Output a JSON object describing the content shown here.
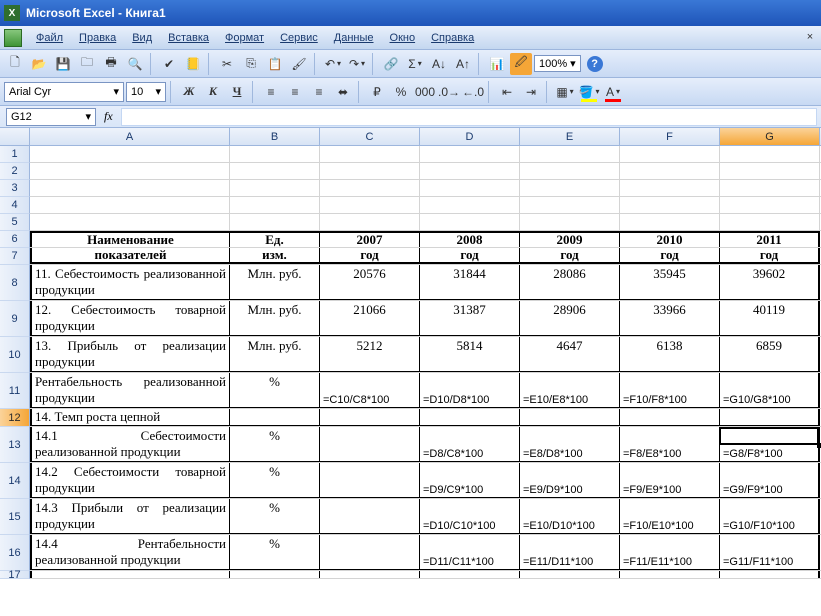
{
  "app": {
    "title": "Microsoft Excel - Книга1"
  },
  "menu": {
    "file": "Файл",
    "edit": "Правка",
    "view": "Вид",
    "insert": "Вставка",
    "format": "Формат",
    "tools": "Сервис",
    "data": "Данные",
    "window": "Окно",
    "help": "Справка"
  },
  "toolbar1": {
    "zoom": "100%"
  },
  "toolbar2": {
    "font_name": "Arial Cyr",
    "font_size": "10",
    "bold": "Ж",
    "italic": "К",
    "underline": "Ч"
  },
  "namebox": "G12",
  "columns": [
    "A",
    "B",
    "C",
    "D",
    "E",
    "F",
    "G"
  ],
  "rows": [
    "1",
    "2",
    "3",
    "4",
    "5",
    "6",
    "7",
    "8",
    "9",
    "10",
    "11",
    "12",
    "13",
    "14",
    "15",
    "16",
    "17"
  ],
  "selected_row": "12",
  "selected_col": "G",
  "table": {
    "header1": {
      "A": "Наименование",
      "B": "Ед.",
      "C": "2007",
      "D": "2008",
      "E": "2009",
      "F": "2010",
      "G": "2011"
    },
    "header2": {
      "A": "показателей",
      "B": "изм.",
      "C": "год",
      "D": "год",
      "E": "год",
      "F": "год",
      "G": "год"
    },
    "r8": {
      "A": "11. Себестоимость реализованной продукции",
      "B": "Млн. руб.",
      "C": "20576",
      "D": "31844",
      "E": "28086",
      "F": "35945",
      "G": "39602"
    },
    "r9": {
      "A": "12. Себестоимость товарной продукции",
      "B": "Млн. руб.",
      "C": "21066",
      "D": "31387",
      "E": "28906",
      "F": "33966",
      "G": "40119"
    },
    "r10": {
      "A": "13. Прибыль от реализации продукции",
      "B": "Млн. руб.",
      "C": "5212",
      "D": "5814",
      "E": "4647",
      "F": "6138",
      "G": "6859"
    },
    "r11": {
      "A": "Рентабельность реализованной продукции",
      "B": "%",
      "C": "=C10/C8*100",
      "D": "=D10/D8*100",
      "E": "=E10/E8*100",
      "F": "=F10/F8*100",
      "G": "=G10/G8*100"
    },
    "r12": {
      "A": "14. Темп роста цепной",
      "B": "",
      "C": "",
      "D": "",
      "E": "",
      "F": "",
      "G": ""
    },
    "r13": {
      "A": "14.1 Себестоимости реализованной продукции",
      "B": "%",
      "C": "",
      "D": "=D8/C8*100",
      "E": "=E8/D8*100",
      "F": "=F8/E8*100",
      "G": "=G8/F8*100"
    },
    "r14": {
      "A": "14.2 Себестоимости товарной продукции",
      "B": "%",
      "C": "",
      "D": "=D9/C9*100",
      "E": "=E9/D9*100",
      "F": "=F9/E9*100",
      "G": "=G9/F9*100"
    },
    "r15": {
      "A": "14.3 Прибыли от реализации продукции",
      "B": "%",
      "C": "",
      "D": "=D10/C10*100",
      "E": "=E10/D10*100",
      "F": "=F10/E10*100",
      "G": "=G10/F10*100"
    },
    "r16": {
      "A": "14.4 Рентабельности реализованной продукции",
      "B": "%",
      "C": "",
      "D": "=D11/C11*100",
      "E": "=E11/D11*100",
      "F": "=F11/E11*100",
      "G": "=G11/F11*100"
    }
  }
}
